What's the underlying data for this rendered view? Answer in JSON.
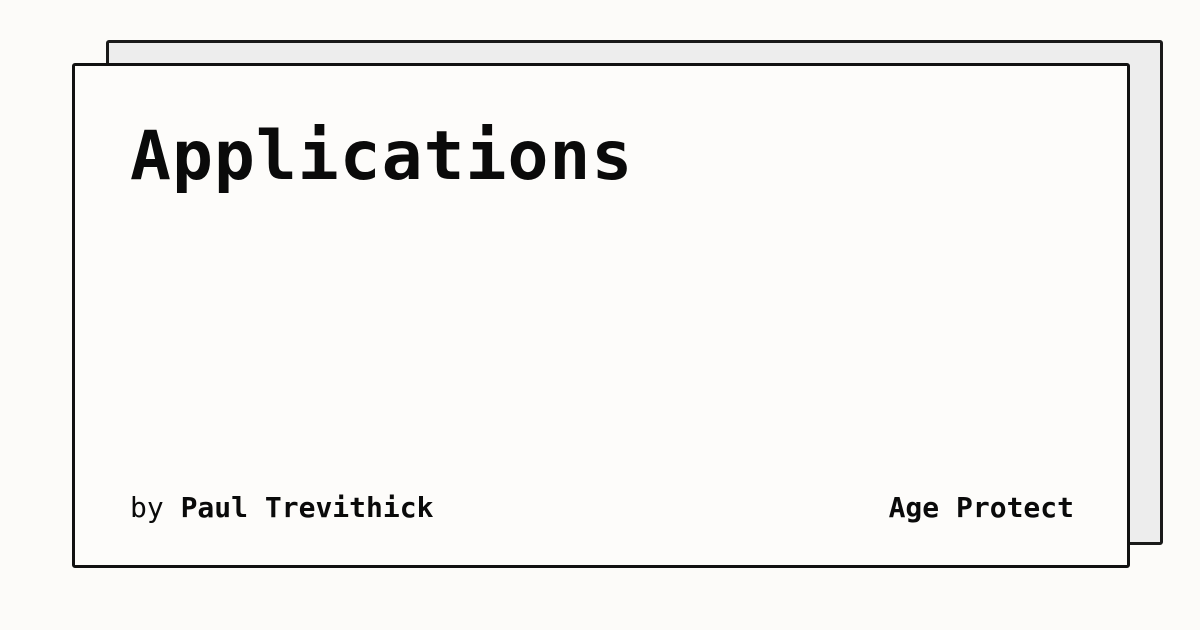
{
  "card": {
    "title": "Applications",
    "byline_prefix": "by",
    "author": "Paul Trevithick",
    "site_name": "Age Protect"
  },
  "colors": {
    "background": "#fcfbf9",
    "card_background": "#fdfcfa",
    "shadow_card": "#ededed",
    "border": "#111111",
    "text": "#0a0a0a"
  }
}
